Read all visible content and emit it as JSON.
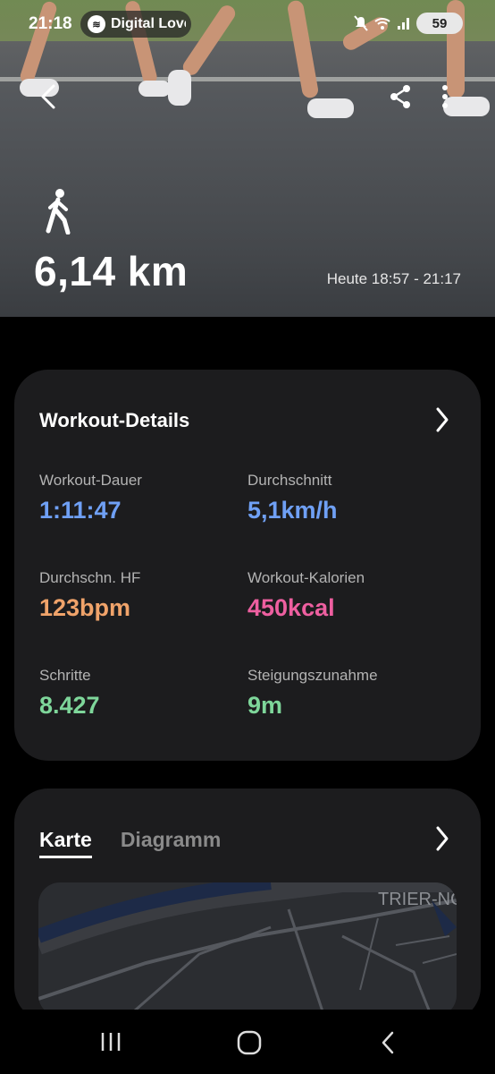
{
  "status_bar": {
    "time": "21:18",
    "now_playing": "Digital Love",
    "battery": "59",
    "icons": [
      "spotify-icon",
      "mute-icon",
      "wifi-icon",
      "signal-icon",
      "battery-icon"
    ]
  },
  "hero": {
    "back_icon": "chevron-left-icon",
    "share_icon": "share-icon",
    "more_icon": "more-vertical-icon",
    "activity_icon": "walking-icon",
    "distance": "6,14 km",
    "time_range": "Heute 18:57 - 21:17"
  },
  "workout_details": {
    "title": "Workout-Details",
    "stats": [
      {
        "label": "Workout-Dauer",
        "value": "1:11:47",
        "color": "#6fa0f5"
      },
      {
        "label": "Durchschnitt",
        "value": "5,1km/h",
        "color": "#6fa0f5"
      },
      {
        "label": "Durchschn. HF",
        "value": "123bpm",
        "color": "#f0a36a"
      },
      {
        "label": "Workout-Kalorien",
        "value": "450kcal",
        "color": "#ee5fa0"
      },
      {
        "label": "Schritte",
        "value": "8.427",
        "color": "#7ed69a"
      },
      {
        "label": "Steigungszunahme",
        "value": "9m",
        "color": "#7ed69a"
      }
    ]
  },
  "map_card": {
    "tabs": [
      {
        "label": "Karte",
        "active": true
      },
      {
        "label": "Diagramm",
        "active": false
      }
    ],
    "map_label": "TRIER-NO"
  },
  "nav_bar": {
    "icons": [
      "recent-apps-icon",
      "home-icon",
      "back-icon"
    ]
  }
}
